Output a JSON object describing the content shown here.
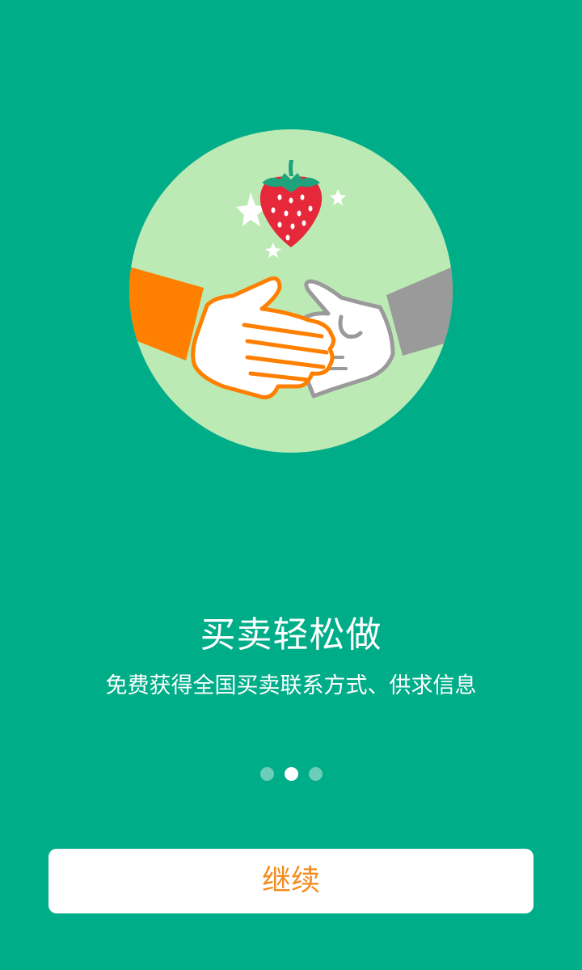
{
  "theme": {
    "background": "#00AD89",
    "circle": "#BCEAB5",
    "orange": "#FF8000",
    "gray": "#9A9A9A",
    "white": "#FFFFFF",
    "strawberry_red": "#E5283A",
    "strawberry_leaf": "#1FA37C",
    "button_text": "#F28C1E",
    "dot_inactive": "#6CCDB8"
  },
  "illustration": {
    "name": "handshake-with-strawberry",
    "icons": [
      "strawberry-icon",
      "sparkle-icon",
      "handshake-icon"
    ]
  },
  "onboarding": {
    "title": "买卖轻松做",
    "subtitle": "免费获得全国买卖联系方式、供求信息"
  },
  "pager": {
    "total": 3,
    "active_index": 1
  },
  "actions": {
    "continue_label": "继续"
  }
}
